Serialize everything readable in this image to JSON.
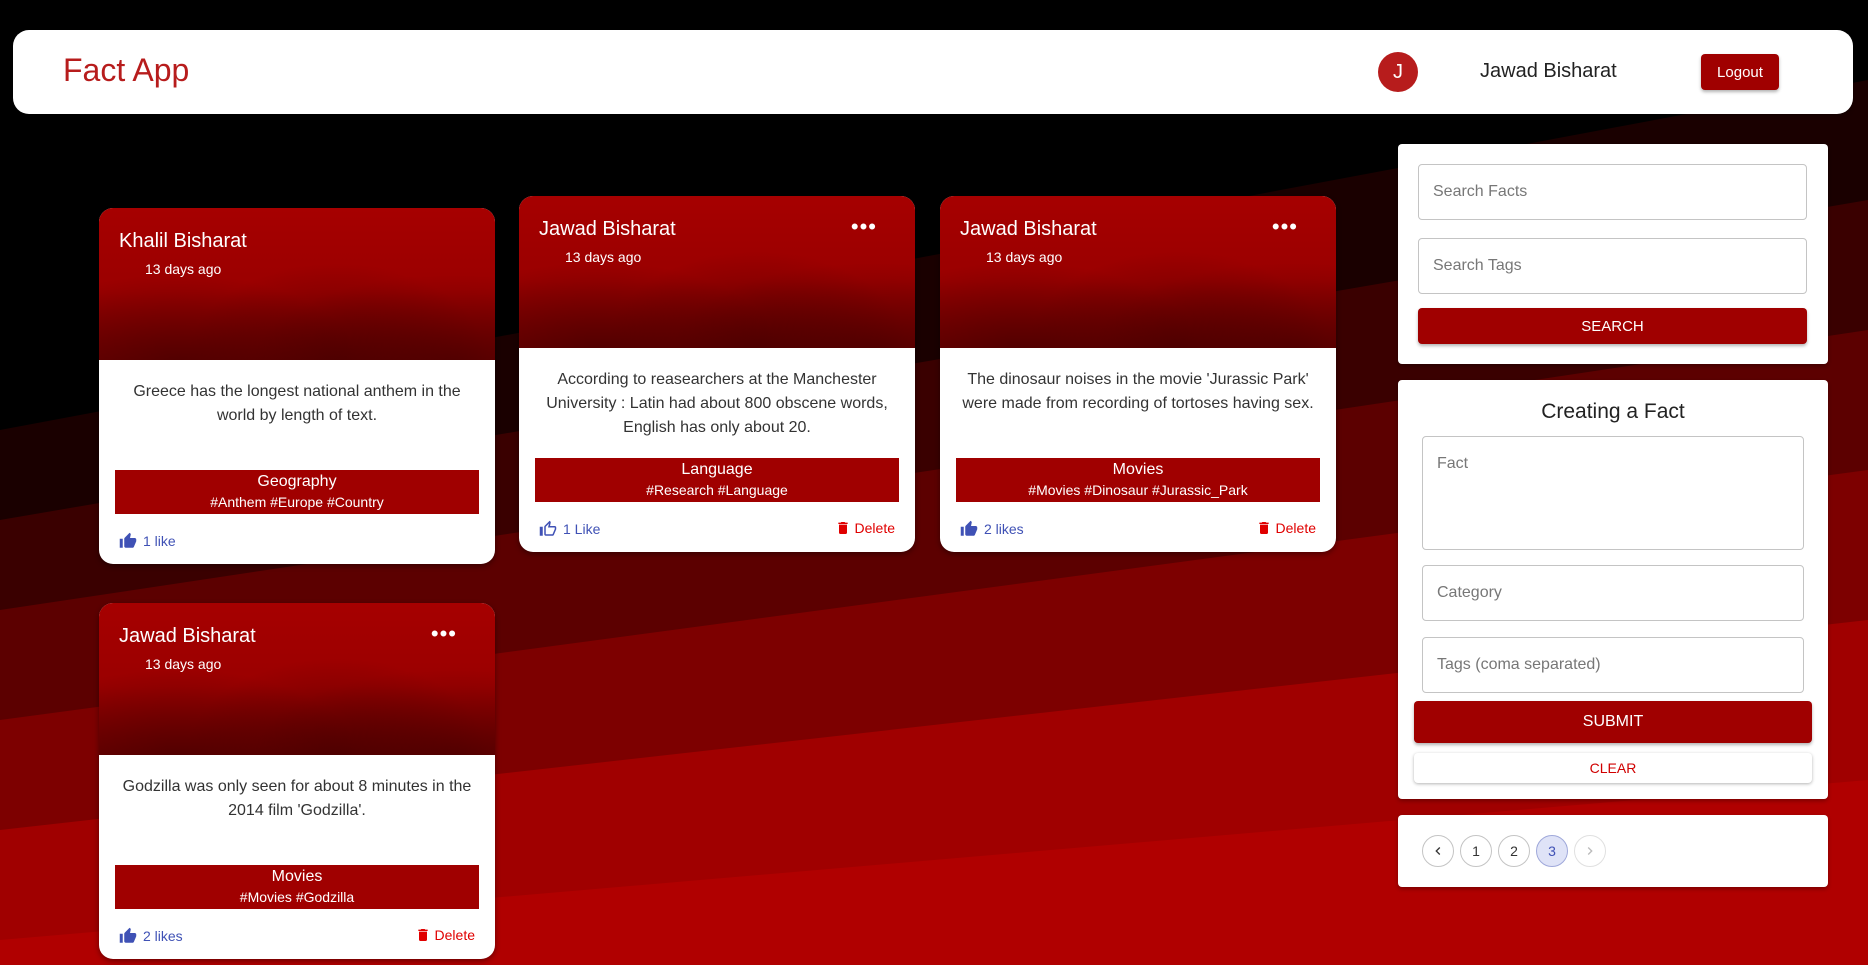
{
  "header": {
    "brand": "Fact App",
    "avatar_initial": "J",
    "username": "Jawad Bisharat",
    "logout_label": "Logout"
  },
  "facts": [
    {
      "author": "Khalil Bisharat",
      "time": "13 days ago",
      "text": "Greece has the longest national anthem in the world by length of text.",
      "category": "Geography",
      "tags": "#Anthem #Europe #Country",
      "likes": "1 like",
      "has_menu": false,
      "delete_label": ""
    },
    {
      "author": "Jawad Bisharat",
      "time": "13 days ago",
      "text": "According to reasearchers at the Manchester University : Latin had about 800 obscene words, English has only about 20.",
      "category": "Language",
      "tags": "#Research #Language",
      "likes": "1 Like",
      "has_menu": true,
      "delete_label": "Delete"
    },
    {
      "author": "Jawad Bisharat",
      "time": "13 days ago",
      "text": "The dinosaur noises in the movie 'Jurassic Park' were made from recording of tortoses having sex.",
      "category": "Movies",
      "tags": "#Movies #Dinosaur #Jurassic_Park",
      "likes": "2 likes",
      "has_menu": true,
      "delete_label": "Delete"
    },
    {
      "author": "Jawad Bisharat",
      "time": "13 days ago",
      "text": "Godzilla was only seen for about 8 minutes in the 2014 film 'Godzilla'.",
      "category": "Movies",
      "tags": "#Movies #Godzilla",
      "likes": "2 likes",
      "has_menu": true,
      "delete_label": "Delete"
    }
  ],
  "search": {
    "facts_placeholder": "Search Facts",
    "tags_placeholder": "Search Tags",
    "button_label": "SEARCH"
  },
  "form": {
    "title": "Creating a Fact",
    "fact_placeholder": "Fact",
    "category_placeholder": "Category",
    "tags_placeholder": "Tags (coma separated)",
    "submit_label": "SUBMIT",
    "clear_label": "CLEAR"
  },
  "pagination": {
    "pages": [
      "1",
      "2",
      "3"
    ],
    "current": "3",
    "prev_icon": "chevron-left-icon",
    "next_icon": "chevron-right-icon"
  },
  "colors": {
    "brand": "#b71c1c",
    "primary": "#a00000",
    "like": "#3f51b5",
    "delete": "#e00000"
  }
}
